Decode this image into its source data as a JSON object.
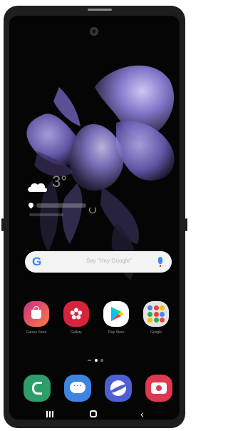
{
  "widget": {
    "temperature": "3°"
  },
  "search_bar": {
    "placeholder": "Say \"Hey Google\""
  },
  "apps": [
    {
      "label": "Galaxy Store",
      "icon": "galaxy-store-icon"
    },
    {
      "label": "Gallery",
      "icon": "gallery-icon"
    },
    {
      "label": "Play Store",
      "icon": "play-store-icon"
    },
    {
      "label": "Google",
      "icon": "google-folder-icon"
    }
  ],
  "dock": [
    {
      "icon": "phone-icon"
    },
    {
      "icon": "messages-icon"
    },
    {
      "icon": "internet-icon"
    },
    {
      "icon": "camera-icon"
    }
  ],
  "page_indicator": {
    "pages": 2,
    "active": 0
  },
  "navbar": {
    "items": [
      "recents",
      "home",
      "back"
    ],
    "back_glyph": "‹"
  },
  "colors": {
    "phone_frame": "#1e1e1e",
    "screen_bg": "#050505",
    "google_blue": "#4285F4",
    "phone_green": "#2e9d6a",
    "messages_blue": "#3e84e0",
    "internet_purple": "#4d5fd2",
    "camera_red": "#e03850"
  }
}
